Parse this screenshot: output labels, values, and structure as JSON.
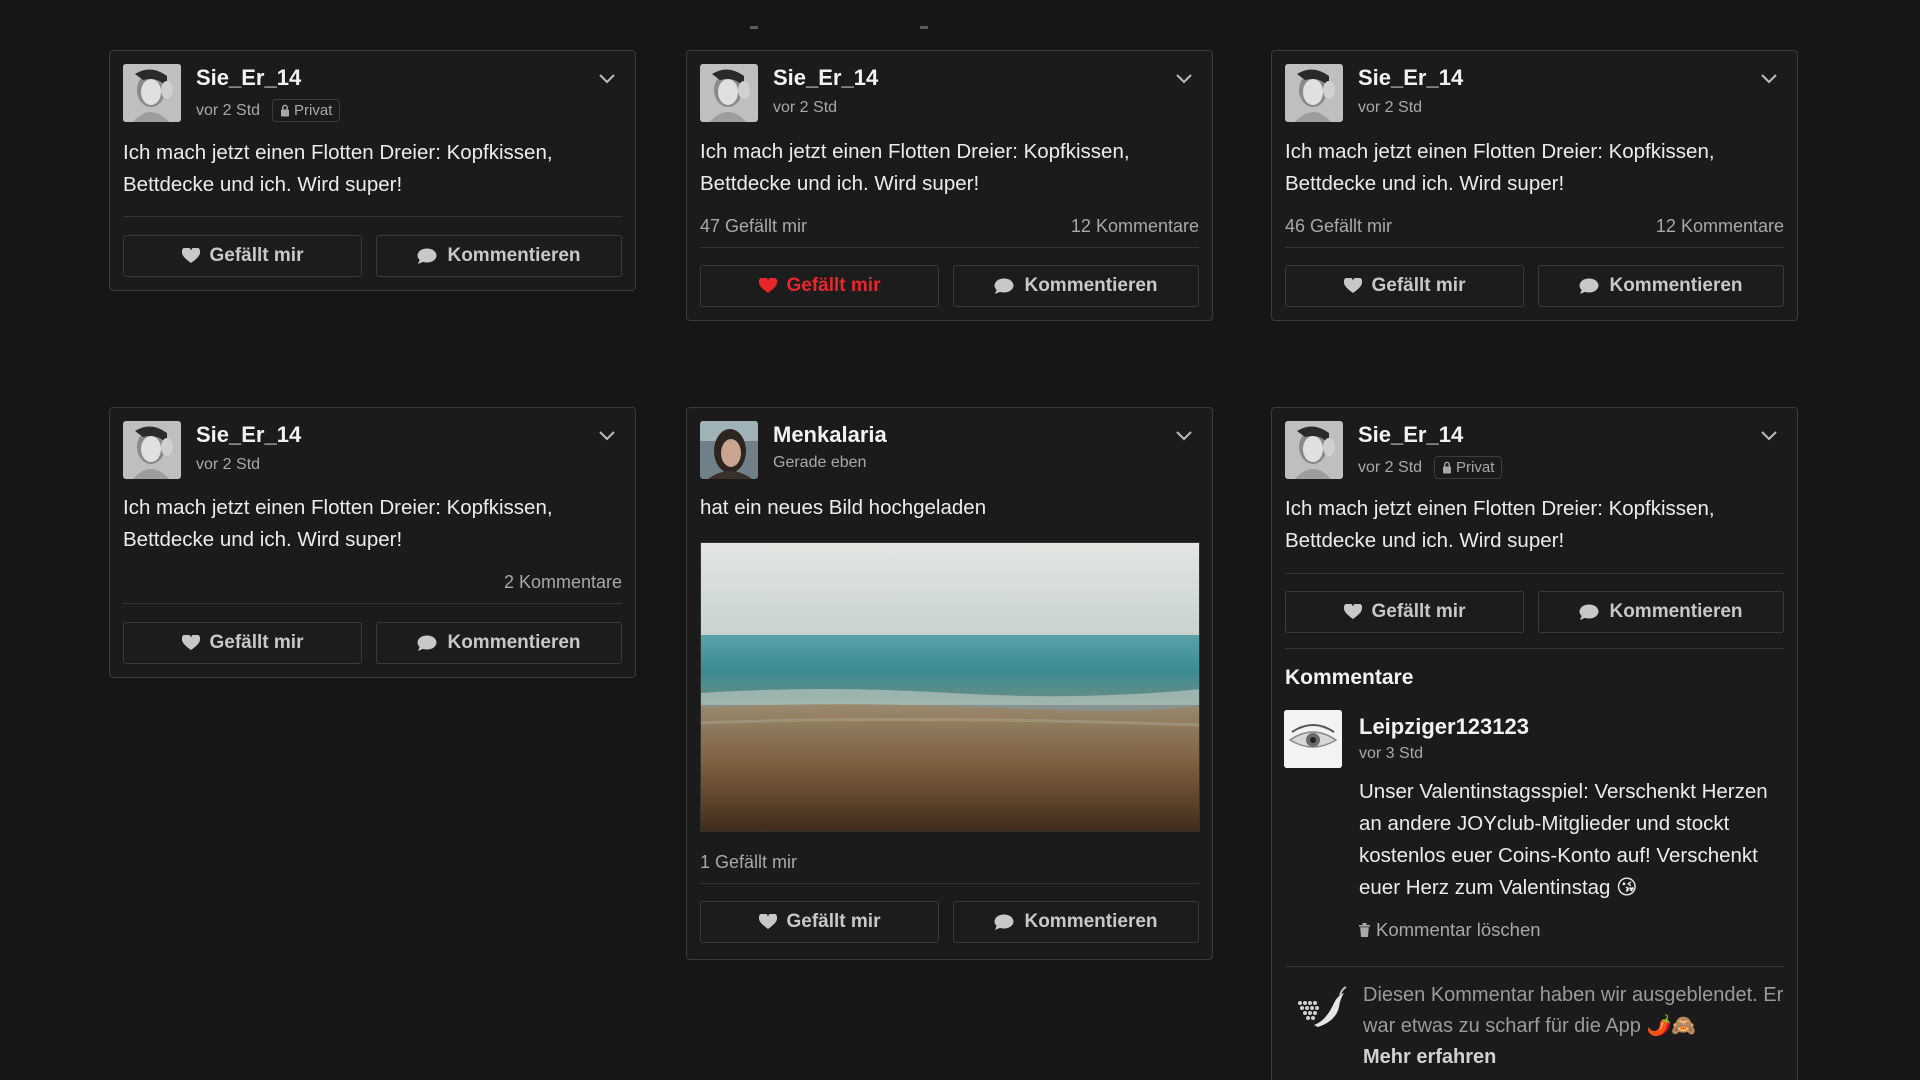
{
  "posts": [
    {
      "username": "Sie_Er_14",
      "time": "vor 2 Std",
      "privacy_label": "Privat",
      "text": "Ich mach jetzt einen Flotten Dreier: Kopfkissen, Bettdecke und ich. Wird super!",
      "like_label": "Gefällt mir",
      "comment_label": "Kommentieren"
    },
    {
      "username": "Sie_Er_14",
      "time": "vor 2 Std",
      "text": "Ich mach jetzt einen Flotten Dreier: Kopfkissen, Bettdecke und ich. Wird super!",
      "likes_count": "47 Gefällt mir",
      "comments_count": "12 Kommentare",
      "like_label": "Gefällt mir",
      "like_active": true,
      "comment_label": "Kommentieren"
    },
    {
      "username": "Sie_Er_14",
      "time": "vor 2 Std",
      "text": "Ich mach jetzt einen Flotten Dreier: Kopfkissen, Bettdecke und ich. Wird super!",
      "likes_count": "46 Gefällt mir",
      "comments_count": "12 Kommentare",
      "like_label": "Gefällt mir",
      "comment_label": "Kommentieren"
    },
    {
      "username": "Sie_Er_14",
      "time": "vor 2 Std",
      "text": "Ich mach jetzt einen Flotten Dreier: Kopfkissen, Bettdecke und ich. Wird super!",
      "comments_count": "2 Kommentare",
      "like_label": "Gefällt mir",
      "comment_label": "Kommentieren"
    },
    {
      "username": "Menkalaria",
      "time": "Gerade eben",
      "text": "hat ein neues Bild hochgeladen",
      "likes_count": "1 Gefällt mir",
      "like_label": "Gefällt mir",
      "comment_label": "Kommentieren"
    },
    {
      "username": "Sie_Er_14",
      "time": "vor 2 Std",
      "privacy_label": "Privat",
      "text": "Ich mach jetzt einen Flotten Dreier: Kopfkissen, Bettdecke und ich. Wird super!",
      "like_label": "Gefällt mir",
      "comment_label": "Kommentieren",
      "comments_title": "Kommentare",
      "comment": {
        "username": "Leipziger123123",
        "time": "vor 3 Std",
        "text": "Unser Valentinstagsspiel: Verschenkt Herzen an andere JOYclub-Mitglieder und stockt kostenlos euer Coins-Konto auf! Verschenkt euer Herz zum Valentinstag 😘",
        "delete_label": "Kommentar löschen"
      },
      "hidden_comment": {
        "text": "Diesen Kommentar haben wir ausgeblendet. Er war etwas zu scharf für die App 🌶️🙈",
        "learn_more": "Mehr erfahren"
      }
    }
  ],
  "colors": {
    "background": "#161616",
    "card": "#1b1b1b",
    "border": "#3a3a3a",
    "like_active": "#e8262c"
  },
  "icons": [
    "chevron-down-icon",
    "lock-icon",
    "heart-icon",
    "speech-bubble-icon",
    "trash-icon",
    "pepper-heart-icon"
  ]
}
